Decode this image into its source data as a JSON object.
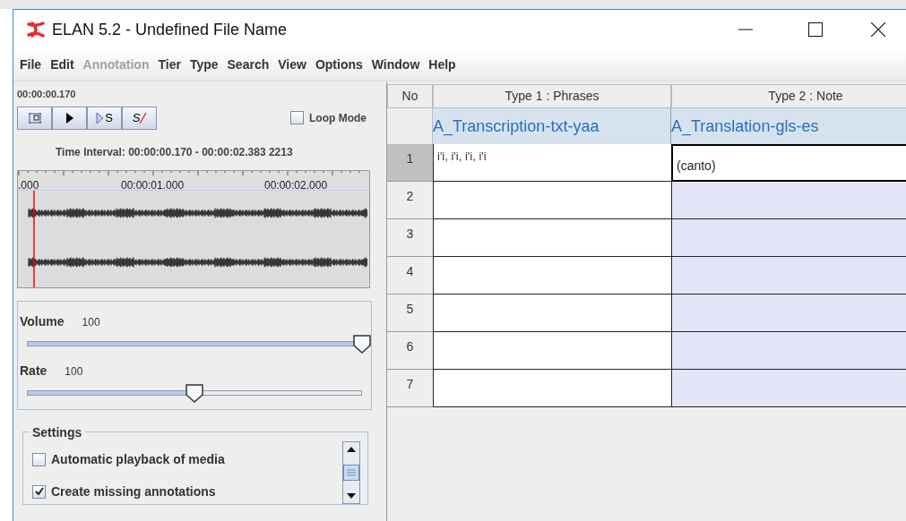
{
  "window": {
    "title": "ELAN 5.2 - Undefined File Name"
  },
  "menu": [
    {
      "label": "File",
      "disabled": false
    },
    {
      "label": "Edit",
      "disabled": false
    },
    {
      "label": "Annotation",
      "disabled": true
    },
    {
      "label": "Tier",
      "disabled": false
    },
    {
      "label": "Type",
      "disabled": false
    },
    {
      "label": "Search",
      "disabled": false
    },
    {
      "label": "View",
      "disabled": false
    },
    {
      "label": "Options",
      "disabled": false
    },
    {
      "label": "Window",
      "disabled": false
    },
    {
      "label": "Help",
      "disabled": false
    }
  ],
  "player": {
    "time": "00:00:00.170",
    "buttons": [
      {
        "kind": "selection"
      },
      {
        "kind": "play"
      },
      {
        "kind": "play-selection",
        "label": "S"
      },
      {
        "kind": "clear-selection",
        "label": "S"
      }
    ],
    "loop_mode": {
      "label": "Loop Mode",
      "checked": false
    },
    "interval": "Time Interval: 00:00:00.170 - 00:00:02.383  2213",
    "ticks": [
      ".000",
      "00:00:01.000",
      "00:00:02.000"
    ]
  },
  "sliders": [
    {
      "label": "Volume",
      "reading": "100",
      "level": 1
    },
    {
      "label": "Rate",
      "reading": "100",
      "level": 0.5
    }
  ],
  "settings": {
    "title": "Settings",
    "options": [
      {
        "label": "Automatic playback of media",
        "checked": false
      },
      {
        "label": "Create missing annotations",
        "checked": true
      }
    ]
  },
  "table": {
    "columns": [
      "No",
      "Type 1 : Phrases",
      "Type 2 : Note"
    ],
    "tiers": [
      "A_Transcription-txt-yaa",
      "A_Translation-gls-es"
    ],
    "rows": [
      {
        "no": "1",
        "selected": true,
        "cells": [
          "i'i, i'i, i'i, i'i",
          "(canto)"
        ],
        "editing": true
      },
      {
        "no": "2",
        "selected": false,
        "editing": false
      },
      {
        "no": "3",
        "selected": false,
        "editing": false
      },
      {
        "no": "4",
        "selected": false,
        "editing": false
      },
      {
        "no": "5",
        "selected": false,
        "editing": false
      },
      {
        "no": "6",
        "selected": false,
        "editing": false
      },
      {
        "no": "7",
        "selected": false,
        "editing": false
      }
    ]
  }
}
